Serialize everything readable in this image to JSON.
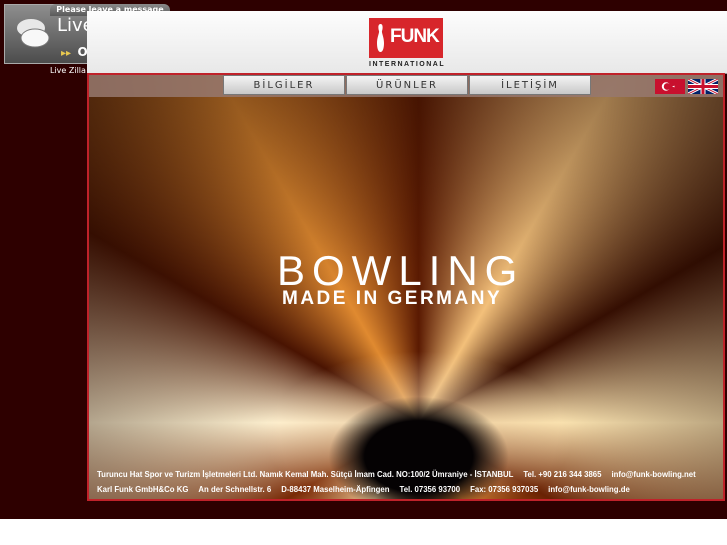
{
  "livezilla": {
    "message_label": "Please leave a message",
    "title": "Live",
    "status_arrows": "▸▸",
    "status_text": "O",
    "caption": "Live Zilla"
  },
  "header": {
    "logo_text": "FUNK",
    "logo_subtitle": "INTERNATIONAL"
  },
  "nav": {
    "items": [
      {
        "label": "BİLGİLER"
      },
      {
        "label": "ÜRÜNLER"
      },
      {
        "label": "İLETİŞİM"
      }
    ]
  },
  "languages": [
    "turkish-flag-icon",
    "uk-flag-icon"
  ],
  "hero": {
    "headline": "BOWLING",
    "subhead": "MADE IN GERMANY"
  },
  "footer": {
    "line1": [
      "Turuncu Hat Spor ve Turizm İşletmeleri Ltd. Namık Kemal Mah. Sütçü İmam Cad. NO:100/2 Ümraniye - İSTANBUL",
      "Tel. +90 216 344 3865",
      "info@funk-bowling.net"
    ],
    "line2": [
      "Karl Funk GmbH&Co KG",
      "An der Schnellstr. 6",
      "D-88437 Maselheim-Äpfingen",
      "Tel. 07356 93700",
      "Fax: 07356 937035",
      "info@funk-bowling.de"
    ]
  },
  "colors": {
    "background": "#2e0000",
    "brand_red": "#d7262b",
    "frame_border": "#c0222a"
  }
}
